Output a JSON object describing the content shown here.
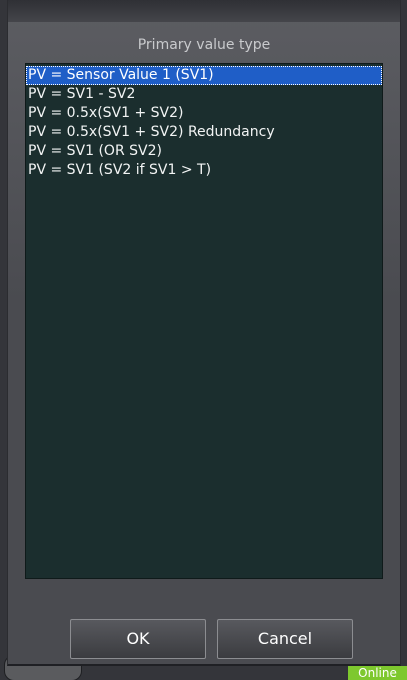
{
  "dialog": {
    "title": "Primary value type",
    "options": [
      {
        "label": "PV = Sensor Value 1 (SV1)",
        "selected": true
      },
      {
        "label": "PV = SV1 - SV2",
        "selected": false
      },
      {
        "label": "PV = 0.5x(SV1 + SV2)",
        "selected": false
      },
      {
        "label": "PV = 0.5x(SV1 + SV2) Redundancy",
        "selected": false
      },
      {
        "label": "PV = SV1 (OR SV2)",
        "selected": false
      },
      {
        "label": "PV = SV1 (SV2 if SV1 > T)",
        "selected": false
      }
    ],
    "ok_label": "OK",
    "cancel_label": "Cancel"
  },
  "background": {
    "status_label": "Online",
    "status_color": "#7ec82e"
  },
  "colors": {
    "selection": "#1f5ec7",
    "list_background": "#1b2e2e"
  }
}
